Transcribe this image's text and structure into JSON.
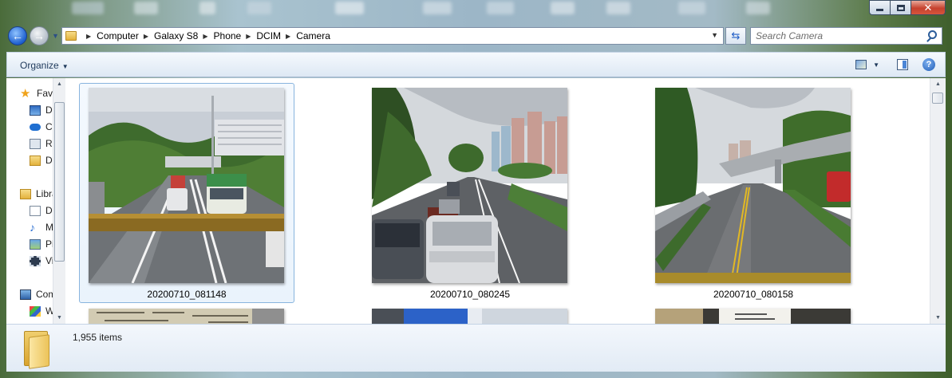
{
  "window": {
    "close_glyph": "✕"
  },
  "nav": {
    "back_glyph": "←",
    "forward_glyph": "→",
    "breadcrumbs": [
      "Computer",
      "Galaxy S8",
      "Phone",
      "DCIM",
      "Camera"
    ],
    "search_placeholder": "Search Camera"
  },
  "toolbar": {
    "organize_label": "Organize",
    "help_glyph": "?"
  },
  "sidebar": {
    "items": [
      {
        "label": "Favorites",
        "icon": "star-icon"
      },
      {
        "label": "Desktop",
        "icon": "desktop-icon"
      },
      {
        "label": "Creative Cloud Files",
        "icon": "cloud-icon"
      },
      {
        "label": "Recent Places",
        "icon": "recent-places-icon"
      },
      {
        "label": "Downloads",
        "icon": "downloads-icon"
      },
      {
        "label": "Libraries",
        "icon": "libraries-icon"
      },
      {
        "label": "Documents",
        "icon": "documents-icon"
      },
      {
        "label": "Music",
        "icon": "music-icon"
      },
      {
        "label": "Pictures",
        "icon": "pictures-icon"
      },
      {
        "label": "Videos",
        "icon": "videos-icon"
      },
      {
        "label": "Computer",
        "icon": "computer-icon"
      },
      {
        "label": "Windows",
        "icon": "windows-drive-icon"
      }
    ]
  },
  "files": [
    {
      "name": "20200710_081148",
      "selected": true
    },
    {
      "name": "20200710_080245",
      "selected": false
    },
    {
      "name": "20200710_080158",
      "selected": false
    }
  ],
  "details": {
    "item_count": "1,955 items"
  }
}
